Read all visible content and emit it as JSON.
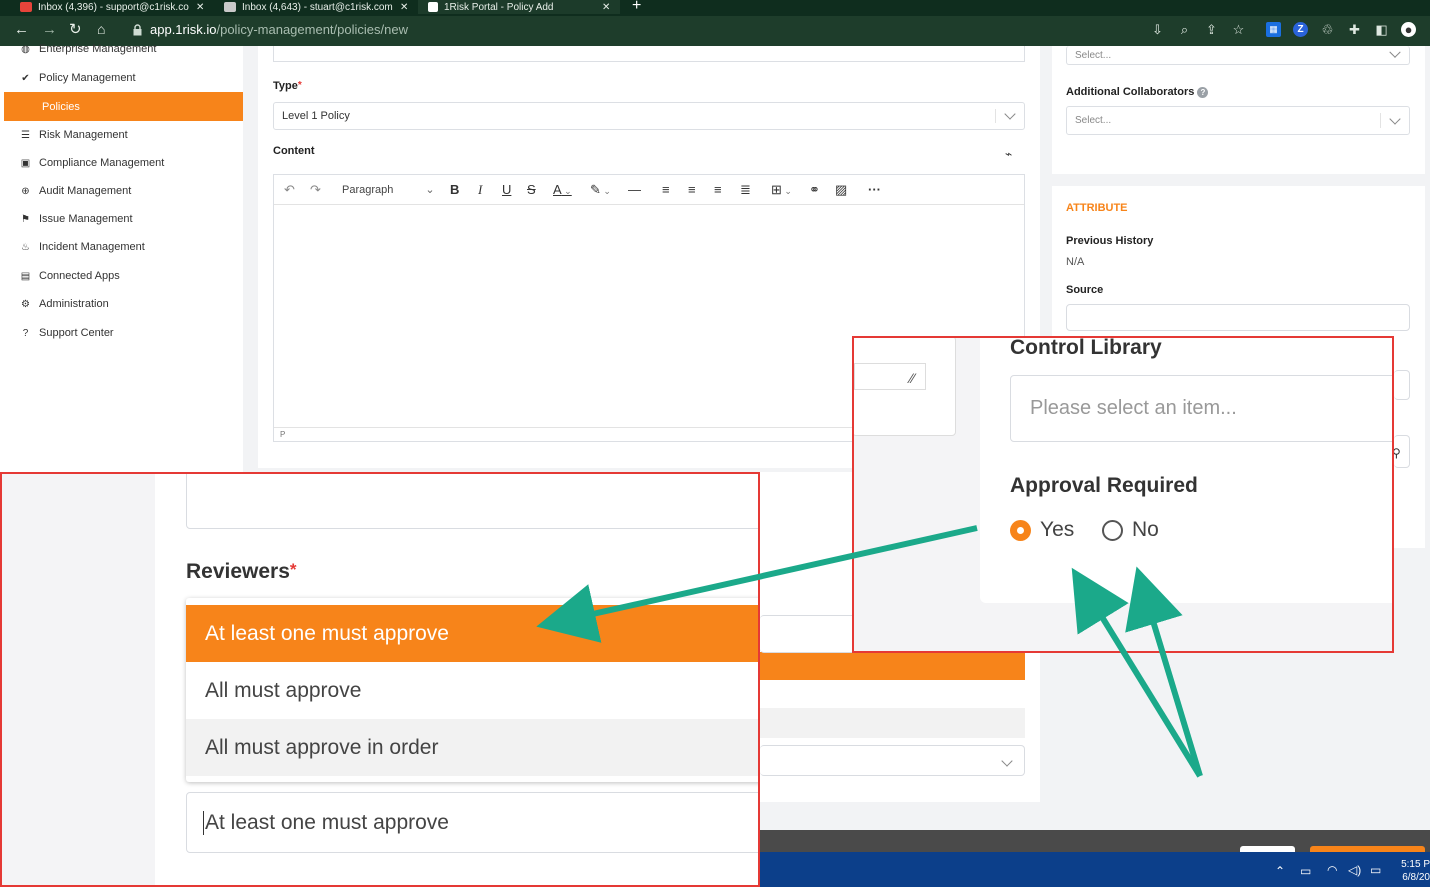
{
  "browser": {
    "tabs": [
      {
        "label": "Inbox (4,396) - support@c1risk.co"
      },
      {
        "label": "Inbox (4,643) - stuart@c1risk.com"
      },
      {
        "label": "1Risk Portal - Policy Add"
      }
    ],
    "url_host": "app.1risk.io",
    "url_path": "/policy-management/policies/new"
  },
  "sidebar": {
    "items": [
      {
        "label": "Enterprise Management",
        "icon": "globe-icon"
      },
      {
        "label": "Policy Management",
        "icon": "check-icon"
      },
      {
        "label": "Policies",
        "active": true
      },
      {
        "label": "Risk Management",
        "icon": "list-icon"
      },
      {
        "label": "Compliance Management",
        "icon": "clipboard-icon"
      },
      {
        "label": "Audit Management",
        "icon": "crosshair-icon"
      },
      {
        "label": "Issue Management",
        "icon": "flag-icon"
      },
      {
        "label": "Incident Management",
        "icon": "fire-icon"
      },
      {
        "label": "Connected Apps",
        "icon": "apps-icon"
      },
      {
        "label": "Administration",
        "icon": "gear-icon"
      },
      {
        "label": "Support Center",
        "icon": "help-icon"
      }
    ]
  },
  "form": {
    "type_label": "Type",
    "type_required": "*",
    "type_value": "Level 1 Policy",
    "content_label": "Content",
    "paragraph_select": "Paragraph",
    "status_path": "P"
  },
  "right": {
    "select_placeholder": "Select...",
    "collaborators_label": "Additional Collaborators",
    "collaborators_placeholder": "Select...",
    "attribute_heading": "ATTRIBUTE",
    "previous_history_label": "Previous History",
    "previous_history_value": "N/A",
    "source_label": "Source"
  },
  "zoom_right": {
    "control_library_label": "Control Library",
    "control_library_placeholder": "Please select an item...",
    "approval_label": "Approval Required",
    "yes": "Yes",
    "no": "No",
    "selected": "Yes"
  },
  "zoom_left": {
    "reviewers_label": "Reviewers",
    "reviewers_required": "*",
    "options": [
      "At least one must approve",
      "All must approve",
      "All must approve in order"
    ],
    "highlighted": "At least one must approve",
    "current_value": "At least one must approve"
  },
  "taskbar": {
    "time": "5:15 P",
    "date": "6/8/20"
  },
  "colors": {
    "accent": "#f7841a",
    "arrow": "#1ba98a",
    "callout_border": "#e53935",
    "browser_bg": "#1e3d2b"
  }
}
